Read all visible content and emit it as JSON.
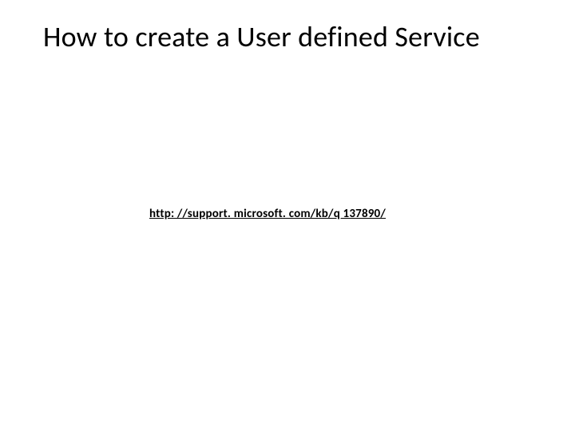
{
  "title": "How to create a User defined Service",
  "link_text": "http: //support. microsoft. com/kb/q 137890/"
}
